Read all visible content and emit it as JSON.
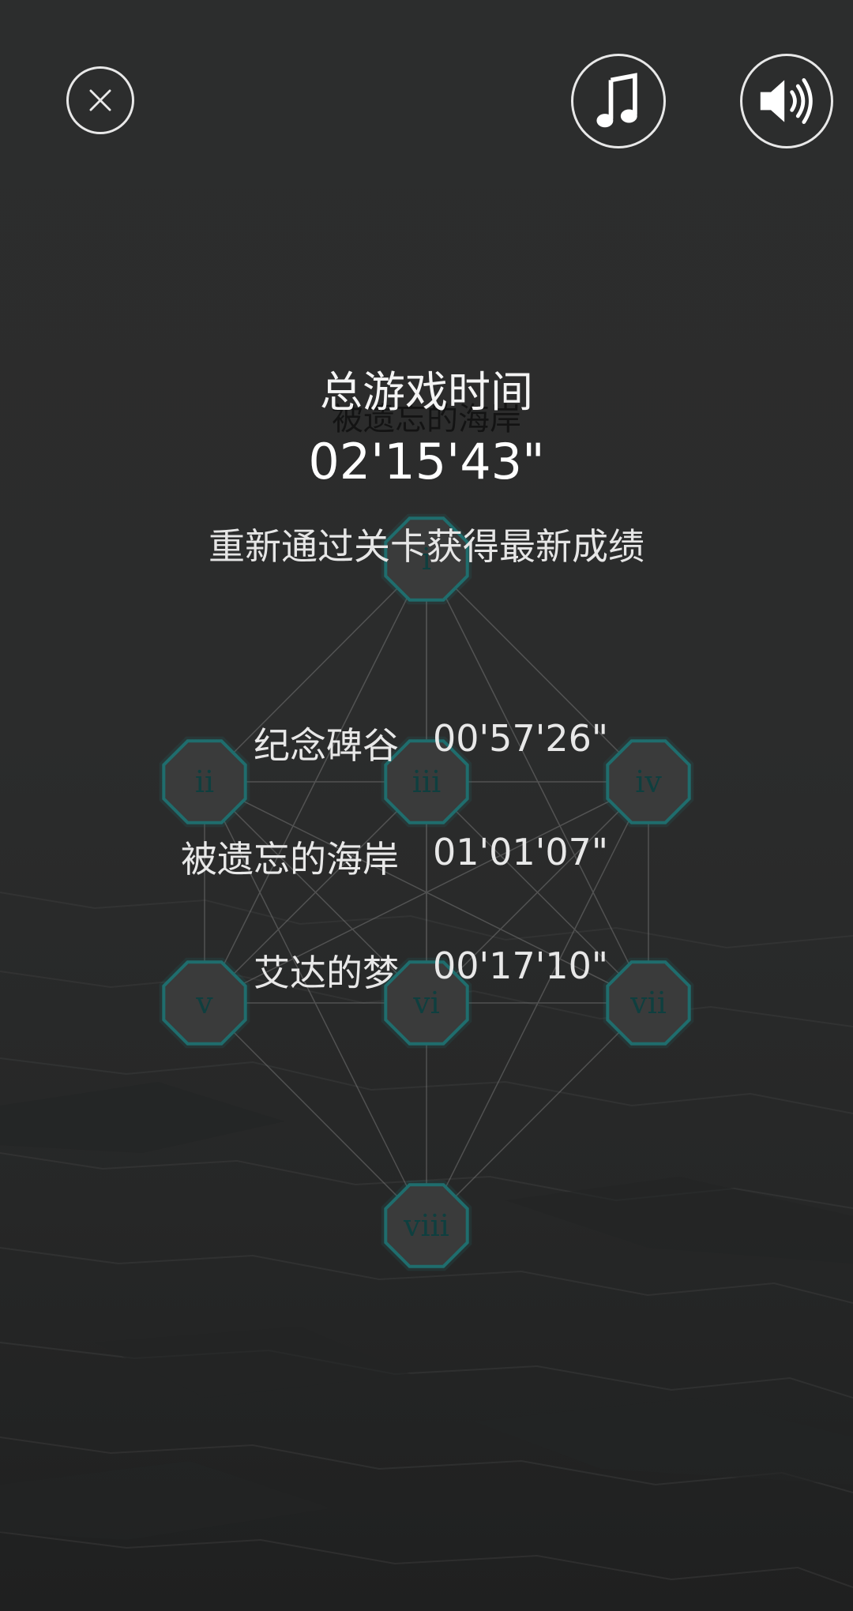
{
  "header": {
    "close_icon": "close-icon",
    "music_icon": "music-note-icon",
    "sound_icon": "speaker-icon"
  },
  "map": {
    "background_title": "被遗忘的海岸",
    "nodes": [
      {
        "id": "i",
        "label": "i"
      },
      {
        "id": "ii",
        "label": "ii"
      },
      {
        "id": "iii",
        "label": "iii"
      },
      {
        "id": "iv",
        "label": "iv"
      },
      {
        "id": "v",
        "label": "v"
      },
      {
        "id": "vi",
        "label": "vi"
      },
      {
        "id": "vii",
        "label": "vii"
      },
      {
        "id": "viii",
        "label": "viii"
      }
    ],
    "accent_color": "#1f6d6d",
    "node_fill": "#3a3b3b"
  },
  "summary": {
    "total_label": "总游戏时间",
    "total_time": "02'15'43\"",
    "hint": "重新通过关卡获得最新成绩",
    "levels": [
      {
        "name": "纪念碑谷",
        "time": "00'57'26\""
      },
      {
        "name": "被遗忘的海岸",
        "time": "01'01'07\""
      },
      {
        "name": "艾达的梦",
        "time": "00'17'10\""
      }
    ]
  }
}
